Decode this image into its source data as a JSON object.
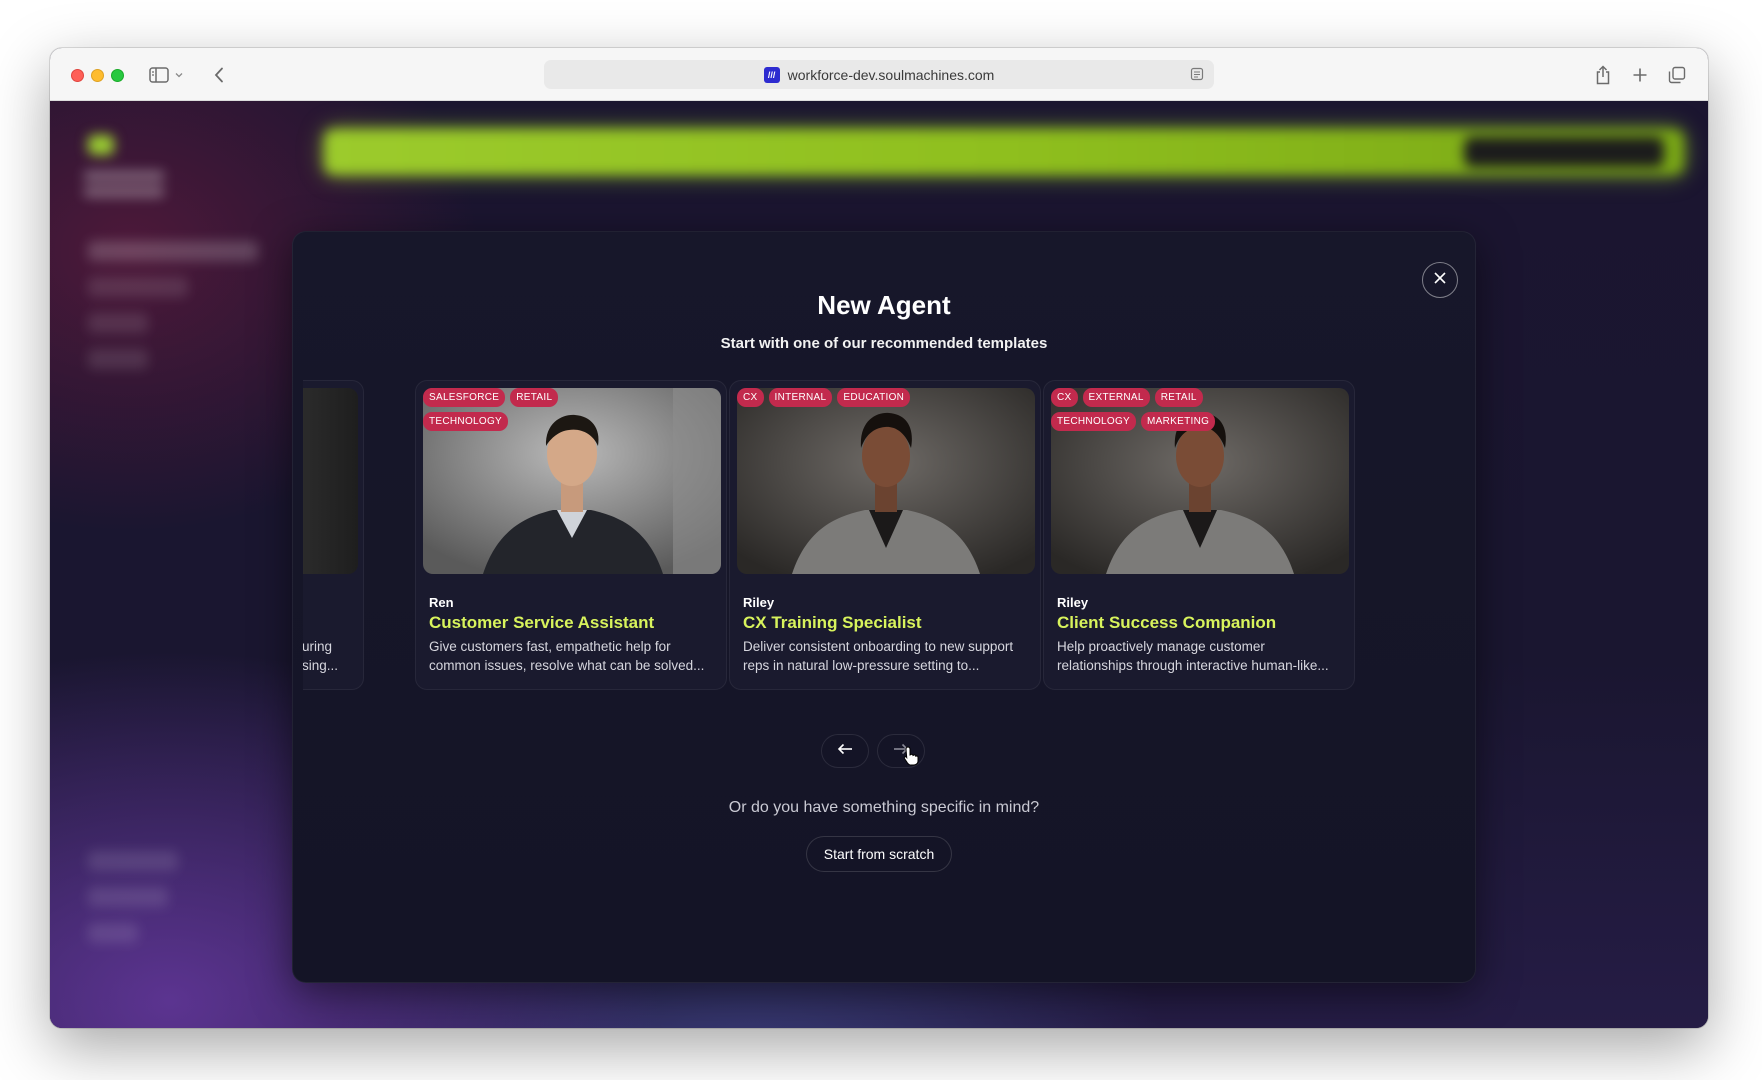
{
  "browser": {
    "url": "workforce-dev.soulmachines.com",
    "favicon_text": "///"
  },
  "modal": {
    "title": "New Agent",
    "subtitle": "Start with one of our recommended templates",
    "prompt": "Or do you have something specific in mind?",
    "scratch_button": "Start from scratch"
  },
  "partial_card": {
    "line1": "uring",
    "line2": "sing..."
  },
  "cards": [
    {
      "name": "Ren",
      "title": "Customer Service Assistant",
      "description": "Give customers fast, empathetic help for common issues, resolve what can be solved...",
      "tags": [
        "SALESFORCE",
        "RETAIL",
        "TECHNOLOGY"
      ]
    },
    {
      "name": "Riley",
      "title": "CX Training Specialist",
      "description": "Deliver consistent onboarding to new support reps in natural low-pressure setting to...",
      "tags": [
        "CX",
        "INTERNAL",
        "EDUCATION"
      ]
    },
    {
      "name": "Riley",
      "title": "Client Success Companion",
      "description": "Help proactively manage customer relationships through interactive human-like...",
      "tags": [
        "CX",
        "EXTERNAL",
        "RETAIL",
        "TECHNOLOGY",
        "MARKETING"
      ]
    }
  ],
  "icons": {
    "close": "close-icon",
    "prev": "arrow-left-icon",
    "next": "arrow-right-icon"
  },
  "colors": {
    "accent_title": "#d8f35c",
    "tag_bg": "#c22a4d",
    "modal_bg": "#17172a",
    "banner": "#9ccb2c"
  }
}
